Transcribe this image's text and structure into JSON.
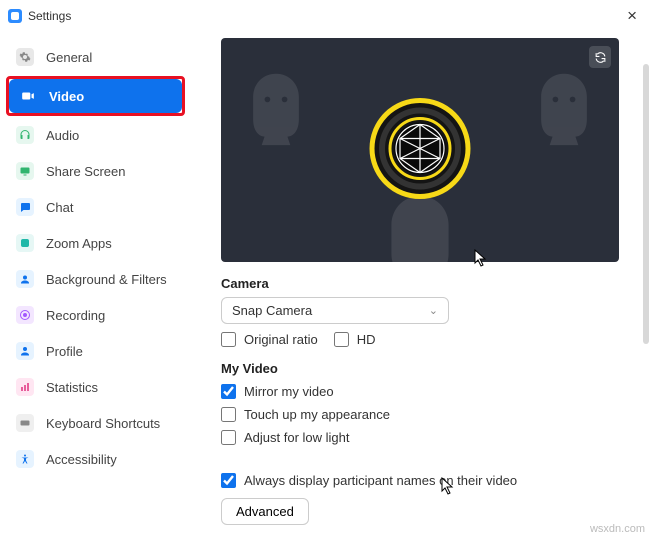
{
  "window": {
    "title": "Settings"
  },
  "sidebar": {
    "items": [
      {
        "label": "General"
      },
      {
        "label": "Video"
      },
      {
        "label": "Audio"
      },
      {
        "label": "Share Screen"
      },
      {
        "label": "Chat"
      },
      {
        "label": "Zoom Apps"
      },
      {
        "label": "Background & Filters"
      },
      {
        "label": "Recording"
      },
      {
        "label": "Profile"
      },
      {
        "label": "Statistics"
      },
      {
        "label": "Keyboard Shortcuts"
      },
      {
        "label": "Accessibility"
      }
    ]
  },
  "video": {
    "camera_label": "Camera",
    "camera_selected": "Snap Camera",
    "original_ratio": "Original ratio",
    "hd": "HD",
    "my_video_label": "My Video",
    "mirror": "Mirror my video",
    "touchup": "Touch up my appearance",
    "lowlight": "Adjust for low light",
    "always_names": "Always display participant names on their video",
    "advanced": "Advanced"
  },
  "watermark": "wsxdn.com"
}
